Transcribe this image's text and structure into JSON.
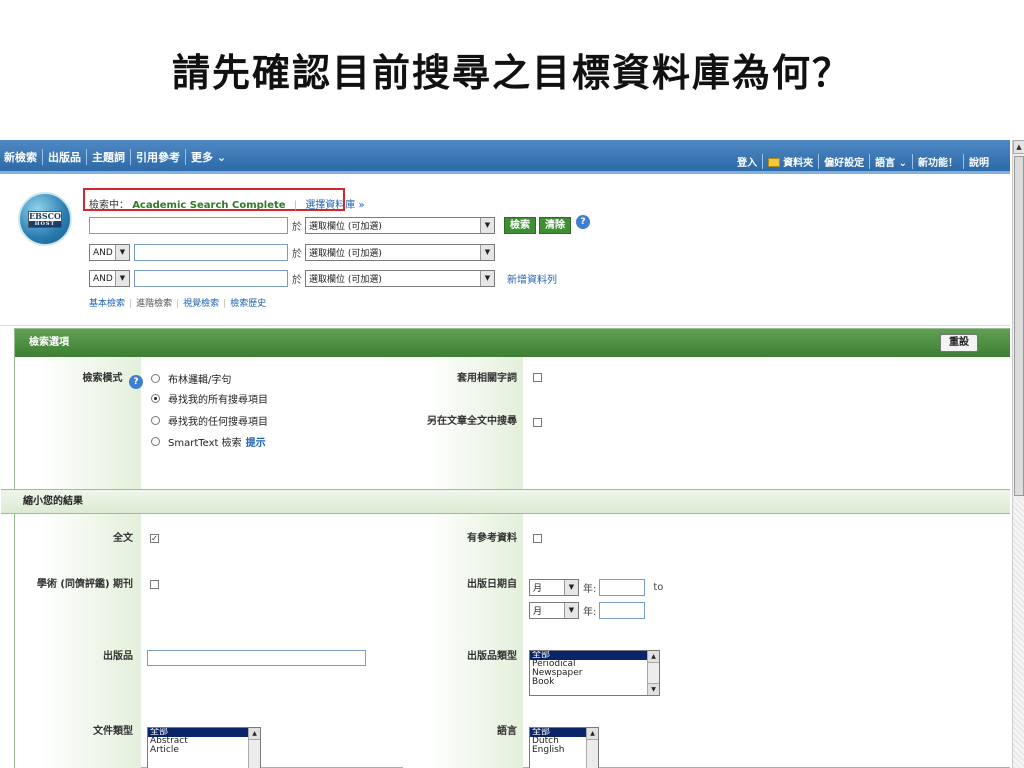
{
  "slide": {
    "title": "請先確認目前搜尋之目標資料庫為何？"
  },
  "topbar": {
    "left": [
      "新檢索",
      "出版品",
      "主題詞",
      "引用參考",
      "更多 ⌄"
    ],
    "right": [
      "登入",
      "資料夾",
      "偏好設定",
      "語言 ⌄",
      "新功能！",
      "說明"
    ]
  },
  "logo": {
    "top": "EBSCO",
    "bottom": "HOST"
  },
  "search": {
    "searching_label": "檢索中：",
    "database": "Academic Search Complete",
    "choose_db": "選擇資料庫 »",
    "in_label": "於",
    "field_select": "選取欄位 (可加選)",
    "bool_op": "AND",
    "search_btn": "檢索",
    "clear_btn": "清除",
    "add_row": "新增資料列",
    "modes": [
      "基本檢索",
      "進階檢索",
      "視覺檢索",
      "檢索歷史"
    ]
  },
  "options": {
    "header": "檢索選項",
    "reset": "重設",
    "mode_label": "檢索模式",
    "modes": [
      "布林邏輯/字句",
      "尋找我的所有搜尋項目",
      "尋找我的任何搜尋項目",
      "SmartText 檢索"
    ],
    "hint": "提示",
    "selected_mode": 1,
    "related_words": "套用相關字詞",
    "fulltext_search": "另在文章全文中搜尋"
  },
  "limits": {
    "header": "縮小您的結果",
    "full_text": "全文",
    "full_text_checked": true,
    "peer_reviewed": "學術 (同儕評鑑) 期刊",
    "publication": "出版品",
    "doc_type": "文件類型",
    "doc_types": [
      "全部",
      "Abstract",
      "Article"
    ],
    "references": "有參考資料",
    "pub_date": "出版日期自",
    "month": "月",
    "year": "年:",
    "to": "to",
    "pub_type": "出版品類型",
    "pub_types": [
      "全部",
      "Periodical",
      "Newspaper",
      "Book"
    ],
    "language": "語言",
    "languages": [
      "全部",
      "Dutch",
      "English"
    ]
  }
}
